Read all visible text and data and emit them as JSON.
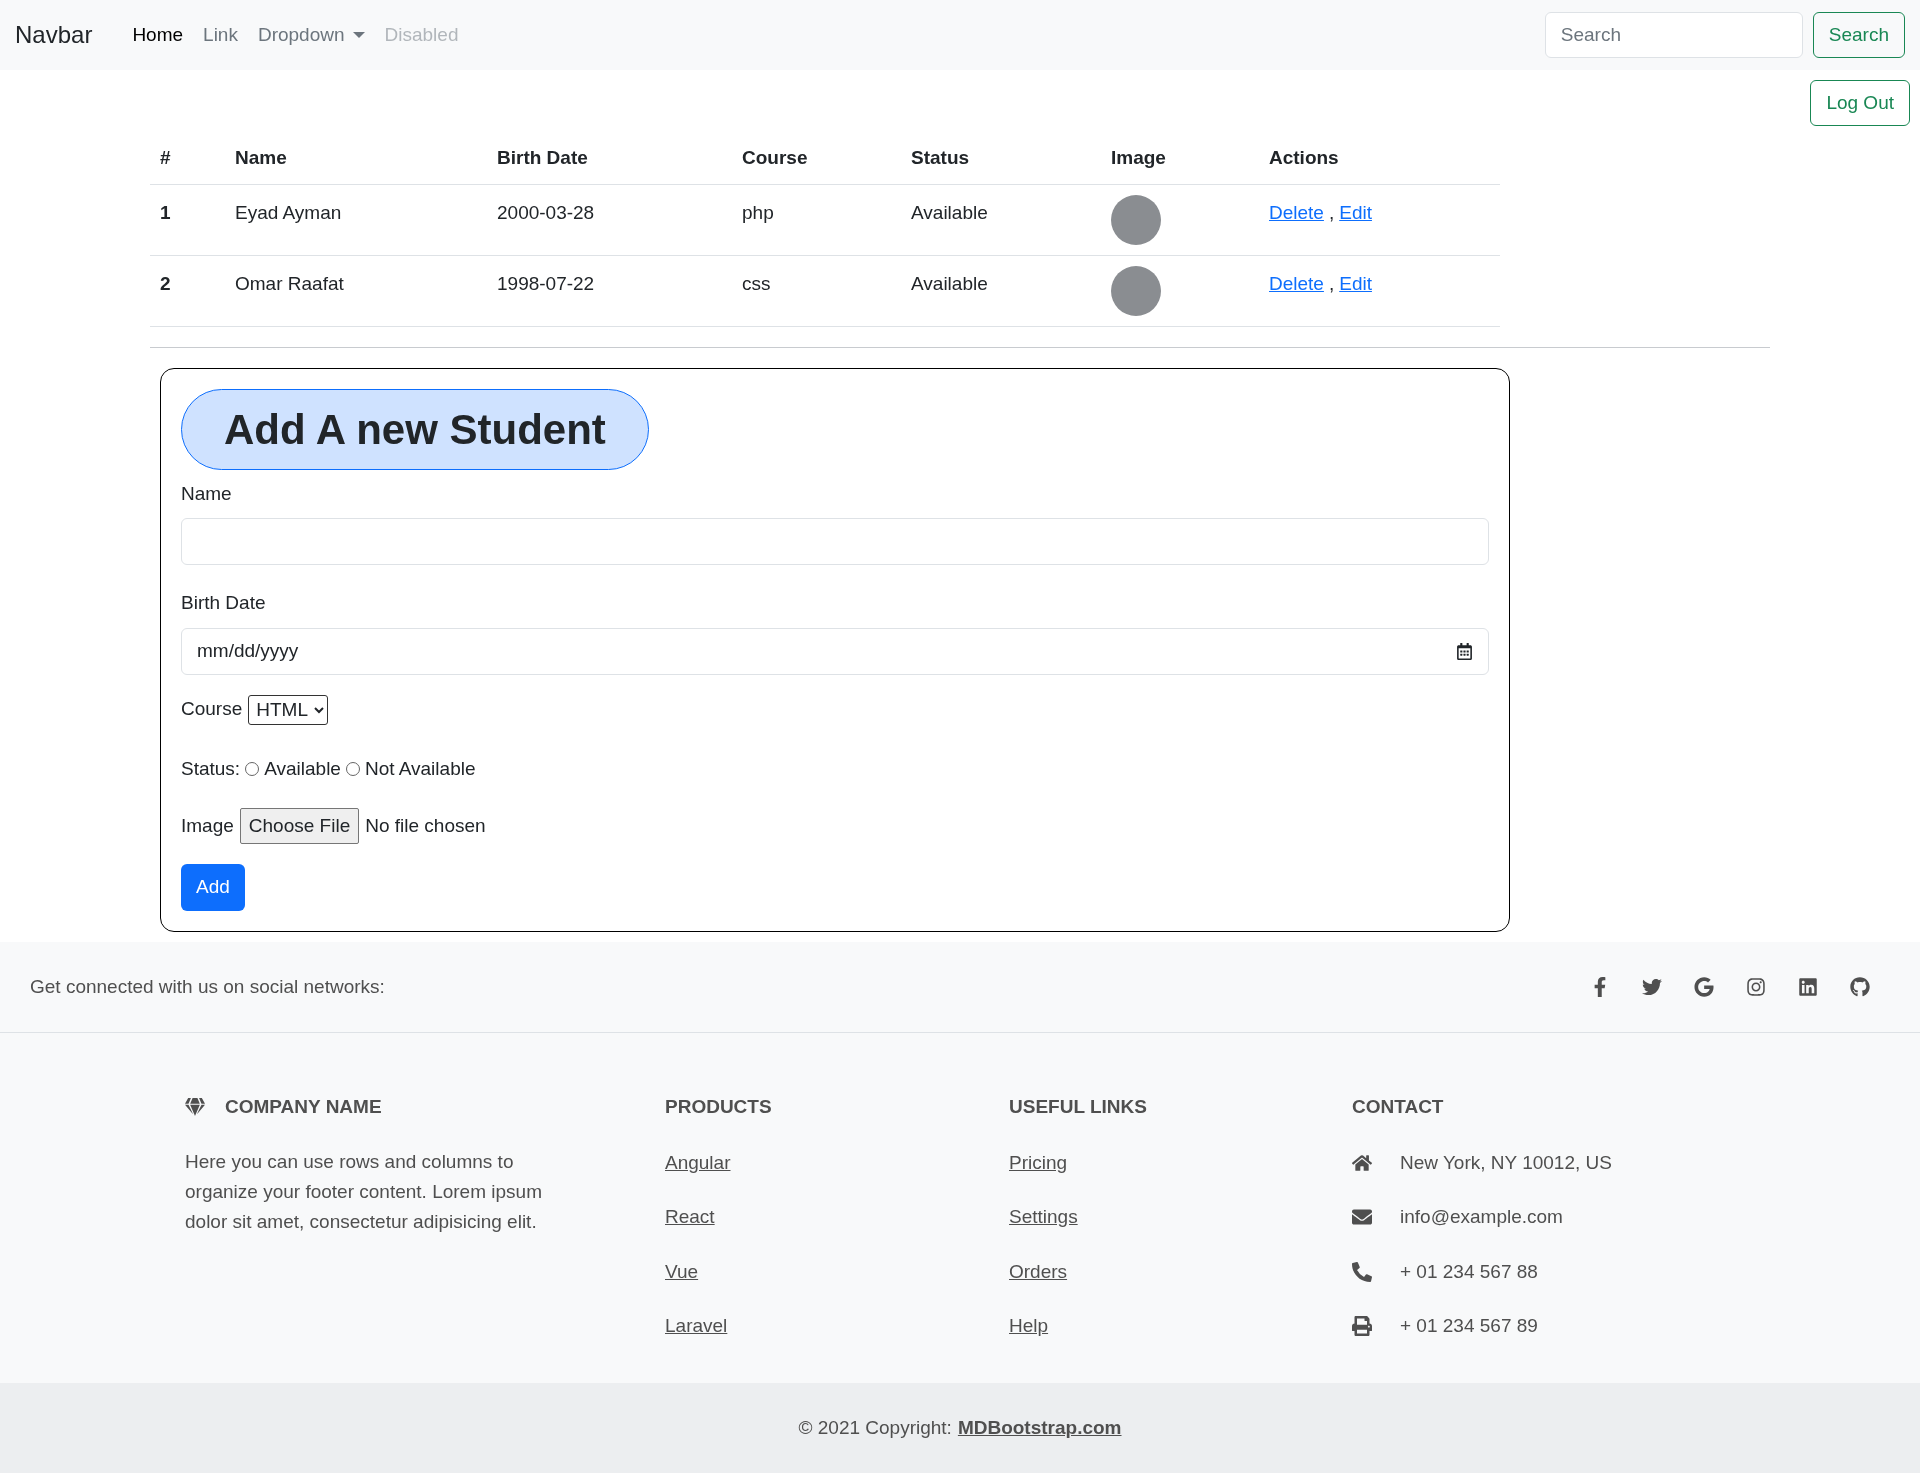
{
  "navbar": {
    "brand": "Navbar",
    "items": [
      {
        "label": "Home",
        "selected": true,
        "disabled": false,
        "dropdown": false
      },
      {
        "label": "Link",
        "selected": false,
        "disabled": false,
        "dropdown": false
      },
      {
        "label": "Dropdown",
        "selected": false,
        "disabled": false,
        "dropdown": true
      },
      {
        "label": "Disabled",
        "selected": false,
        "disabled": true,
        "dropdown": false
      }
    ],
    "search": {
      "placeholder": "Search",
      "button": "Search"
    }
  },
  "logout": "Log Out",
  "table": {
    "columns": [
      "#",
      "Name",
      "Birth Date",
      "Course",
      "Status",
      "Image",
      "Actions"
    ],
    "rows": [
      {
        "index": "1",
        "name": "Eyad Ayman",
        "birth_date": "2000-03-28",
        "course": "php",
        "status": "Available",
        "actions": [
          "Delete",
          "Edit"
        ],
        "separator": ","
      },
      {
        "index": "2",
        "name": "Omar Raafat",
        "birth_date": "1998-07-22",
        "course": "css",
        "status": "Available",
        "actions": [
          "Delete",
          "Edit"
        ],
        "separator": ","
      }
    ]
  },
  "form": {
    "title": "Add A new Student",
    "name_label": "Name",
    "birth_label": "Birth Date",
    "birth_placeholder": "mm/dd/yyyy",
    "course_label": "Course",
    "course_value": "HTML",
    "status_label": "Status:",
    "status_options": [
      {
        "label": "Available",
        "checked": false
      },
      {
        "label": "Not Available",
        "checked": false
      }
    ],
    "image_label": "Image",
    "file_button": "Choose File",
    "file_status": "No file chosen",
    "submit": "Add"
  },
  "social": {
    "text": "Get connected with us on social networks:"
  },
  "footer": {
    "company": {
      "title": "COMPANY NAME",
      "text": "Here you can use rows and columns to organize your footer content. Lorem ipsum dolor sit amet, consectetur adipisicing elit."
    },
    "products": {
      "title": "PRODUCTS",
      "links": [
        "Angular",
        "React",
        "Vue",
        "Laravel"
      ]
    },
    "useful_links": {
      "title": "USEFUL LINKS",
      "links": [
        "Pricing",
        "Settings",
        "Orders",
        "Help"
      ]
    },
    "contact": {
      "title": "CONTACT",
      "items": [
        {
          "kind": "home",
          "text": "New York, NY 10012, US"
        },
        {
          "kind": "email",
          "text": "info@example.com"
        },
        {
          "kind": "phone",
          "text": "+ 01 234 567 88"
        },
        {
          "kind": "print",
          "text": "+ 01 234 567 89"
        }
      ]
    },
    "copyright": {
      "text": "© 2021 Copyright:",
      "link": "MDBootstrap.com"
    }
  }
}
